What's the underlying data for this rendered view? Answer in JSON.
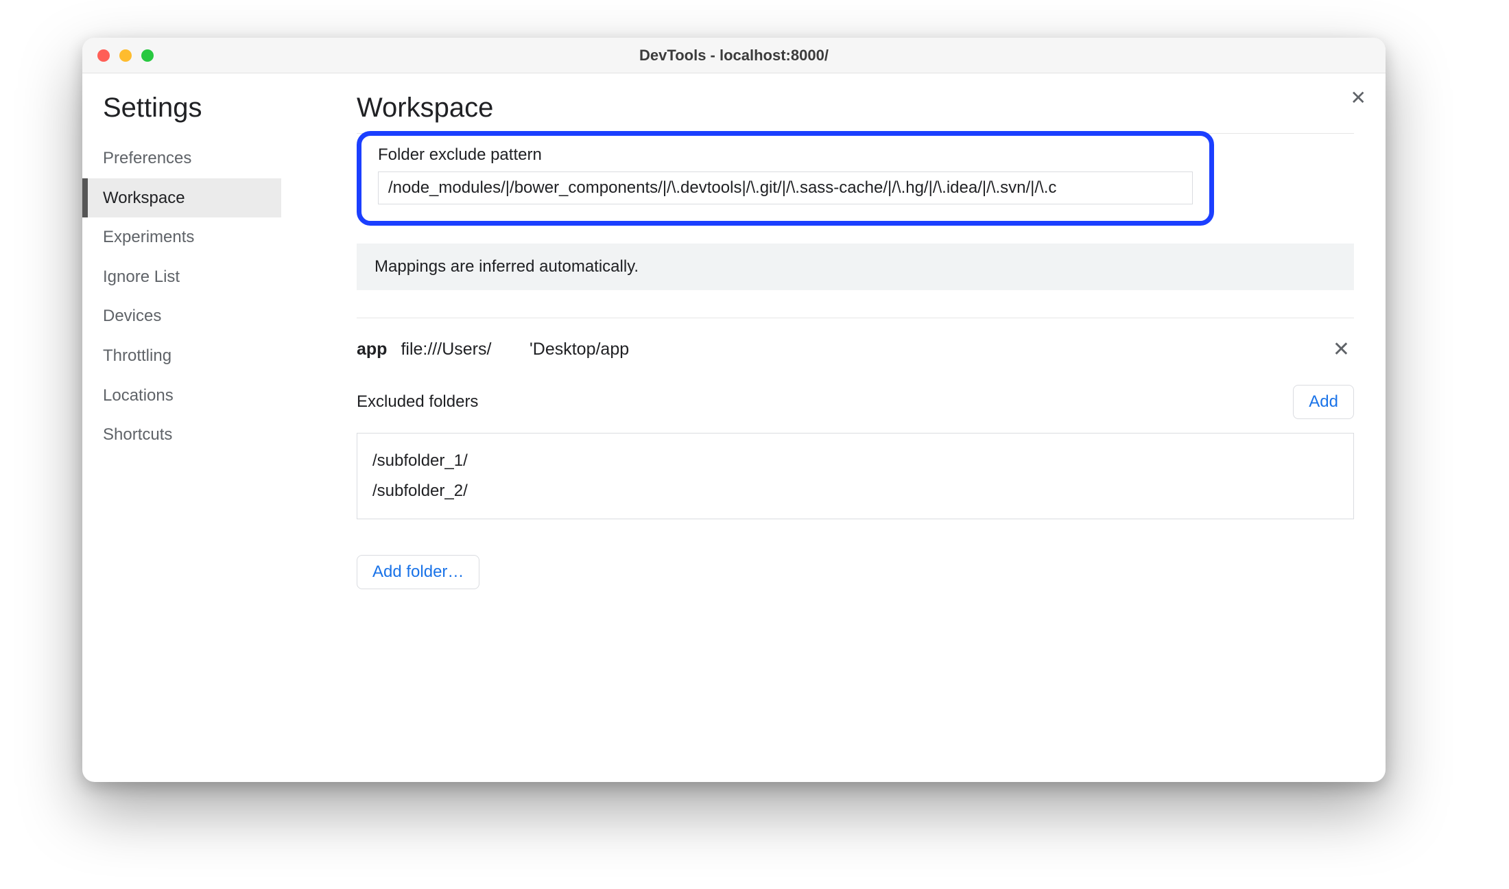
{
  "window": {
    "title": "DevTools - localhost:8000/"
  },
  "sidebar": {
    "title": "Settings",
    "items": [
      {
        "label": "Preferences",
        "selected": false
      },
      {
        "label": "Workspace",
        "selected": true
      },
      {
        "label": "Experiments",
        "selected": false
      },
      {
        "label": "Ignore List",
        "selected": false
      },
      {
        "label": "Devices",
        "selected": false
      },
      {
        "label": "Throttling",
        "selected": false
      },
      {
        "label": "Locations",
        "selected": false
      },
      {
        "label": "Shortcuts",
        "selected": false
      }
    ]
  },
  "main": {
    "heading": "Workspace",
    "exclude_pattern": {
      "label": "Folder exclude pattern",
      "value": "/node_modules/|/bower_components/|/\\.devtools|/\\.git/|/\\.sass-cache/|/\\.hg/|/\\.idea/|/\\.svn/|/\\.c"
    },
    "info_text": "Mappings are inferred automatically.",
    "folder": {
      "name": "app",
      "path": "file:///Users/        'Desktop/app"
    },
    "excluded": {
      "label": "Excluded folders",
      "add_label": "Add",
      "items": [
        "/subfolder_1/",
        "/subfolder_2/"
      ]
    },
    "add_folder_label": "Add folder…"
  }
}
